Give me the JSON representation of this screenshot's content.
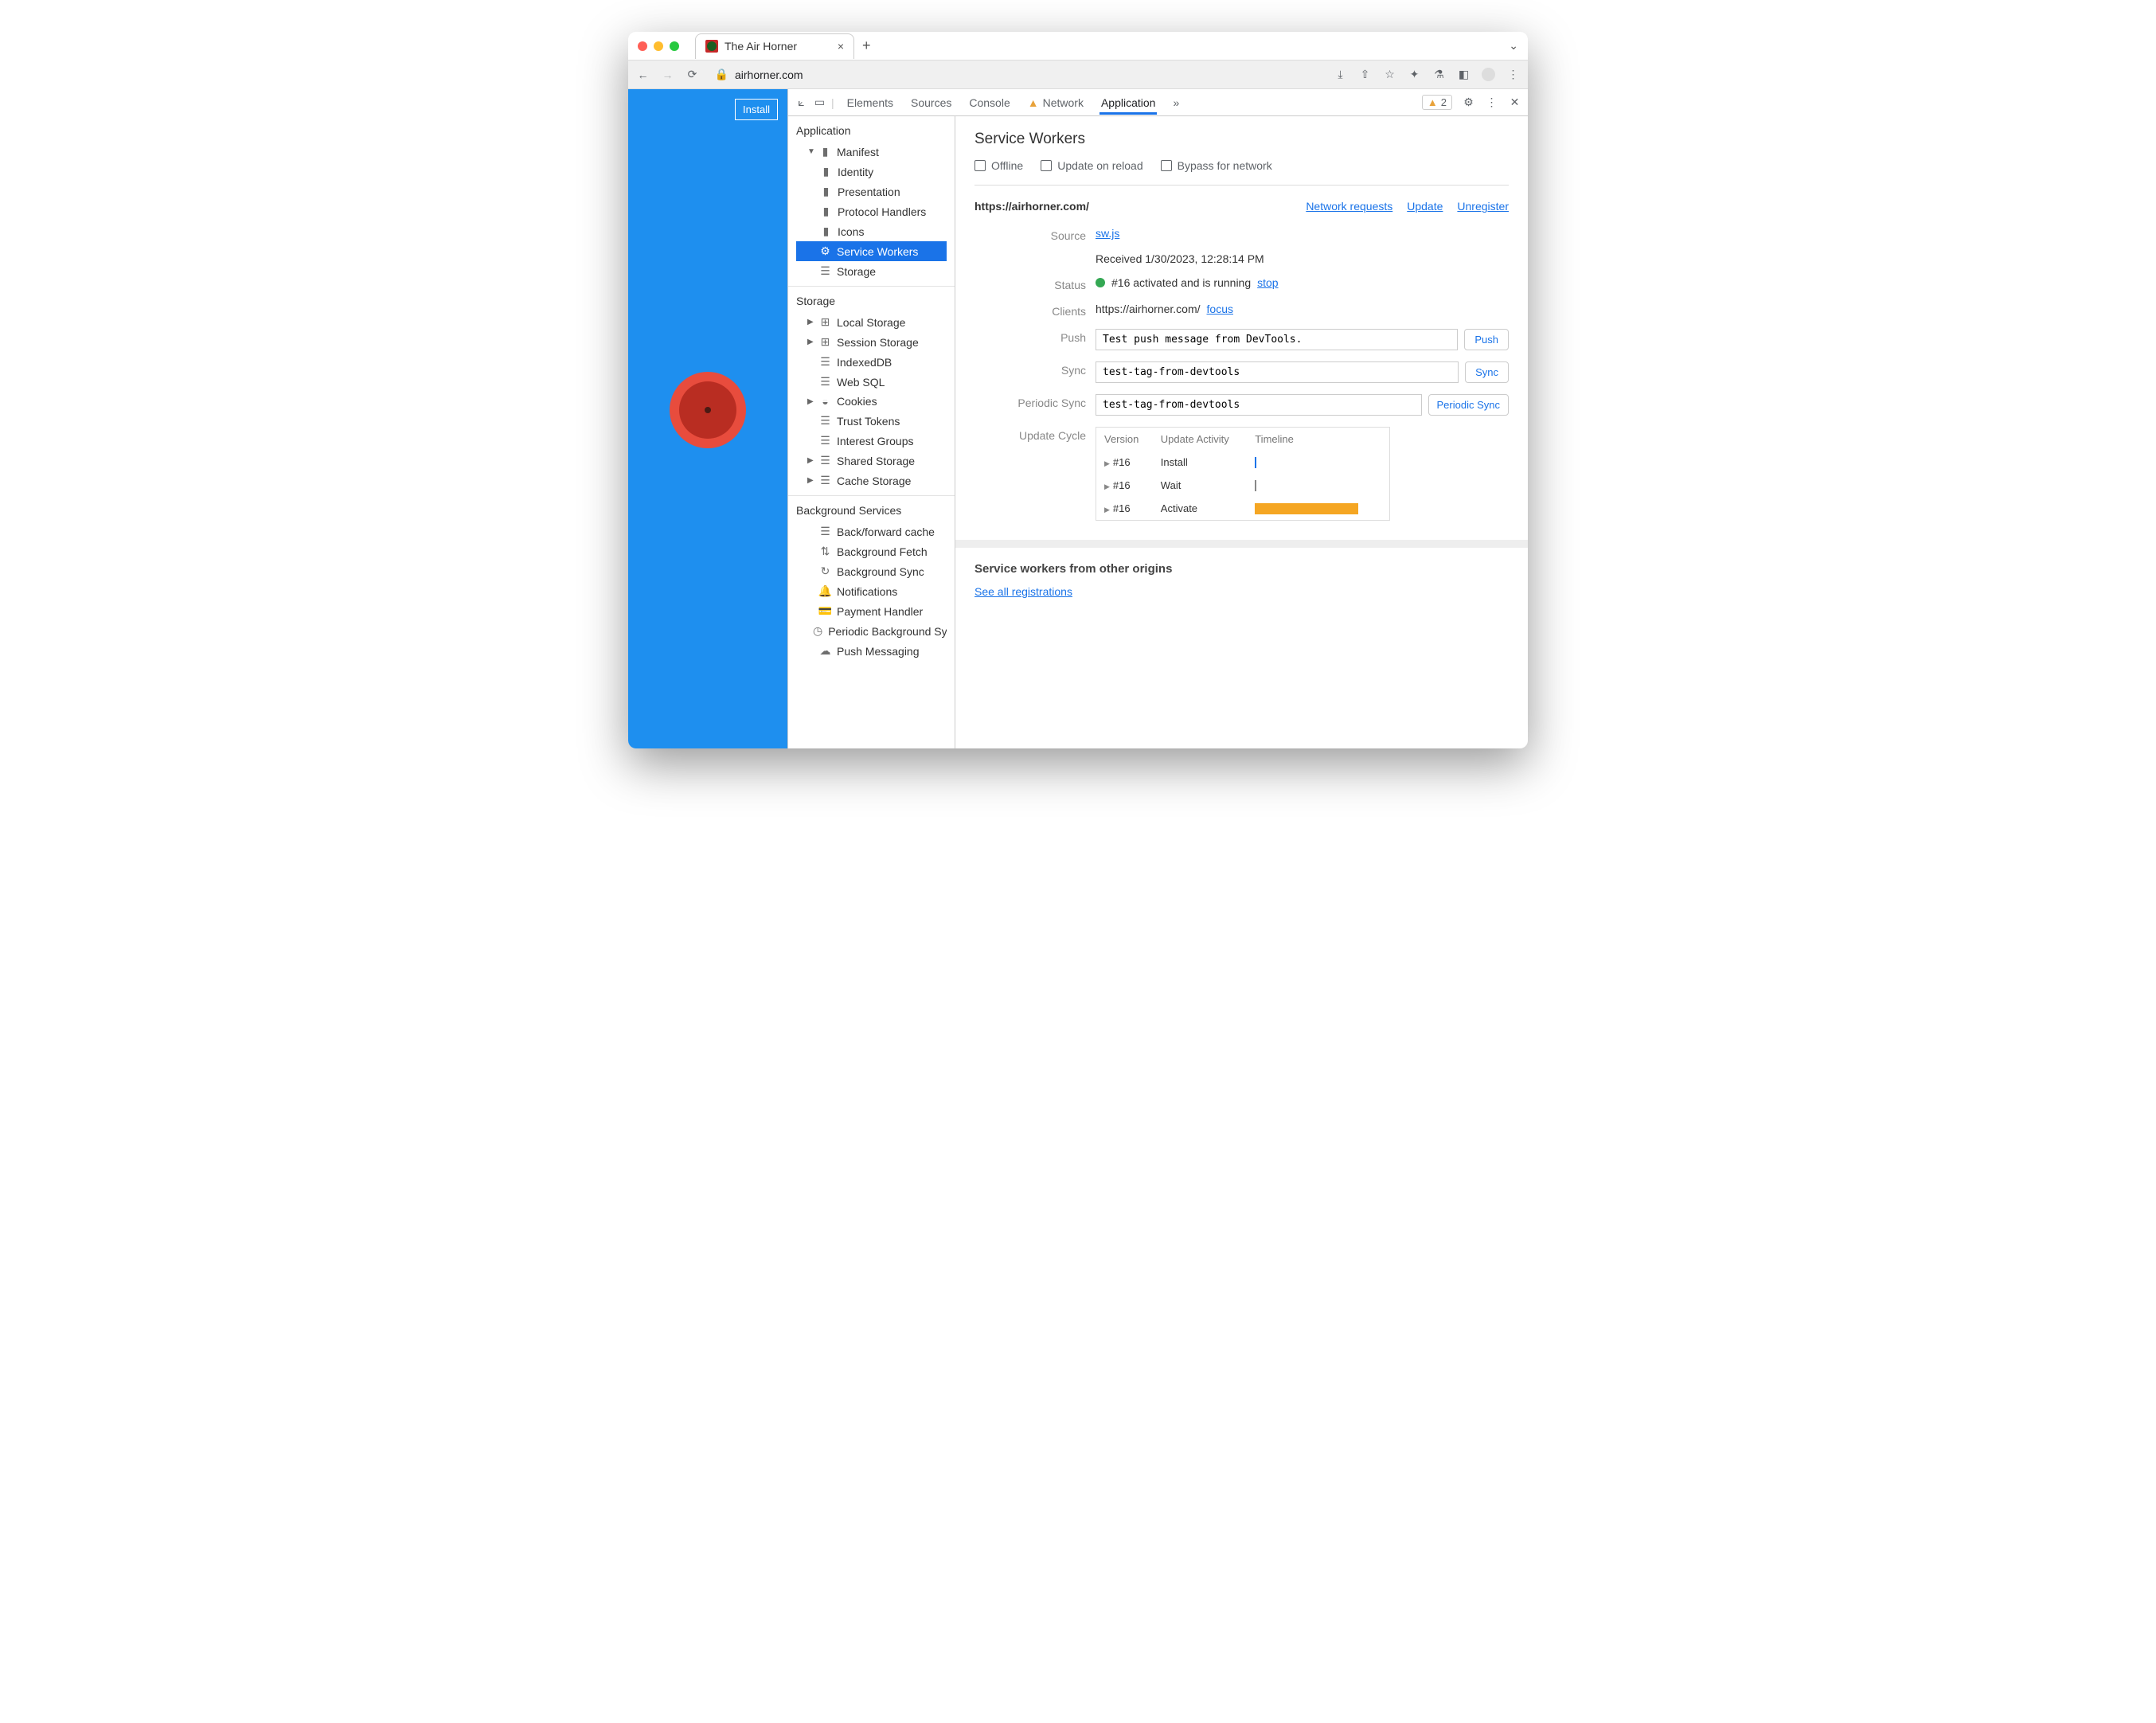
{
  "browser": {
    "tab_title": "The Air Horner",
    "url_display": "airhorner.com"
  },
  "page": {
    "install_label": "Install"
  },
  "devtools": {
    "tabs": {
      "elements": "Elements",
      "sources": "Sources",
      "console": "Console",
      "network": "Network",
      "application": "Application"
    },
    "warning_count": "2"
  },
  "sidebar": {
    "groups": {
      "application": {
        "title": "Application",
        "manifest": "Manifest",
        "identity": "Identity",
        "presentation": "Presentation",
        "protocol": "Protocol Handlers",
        "icons": "Icons",
        "service_workers": "Service Workers",
        "storage": "Storage"
      },
      "storage": {
        "title": "Storage",
        "local": "Local Storage",
        "session": "Session Storage",
        "indexed": "IndexedDB",
        "websql": "Web SQL",
        "cookies": "Cookies",
        "trust": "Trust Tokens",
        "interest": "Interest Groups",
        "shared": "Shared Storage",
        "cache": "Cache Storage"
      },
      "bg": {
        "title": "Background Services",
        "bfcache": "Back/forward cache",
        "bgfetch": "Background Fetch",
        "bgsync": "Background Sync",
        "notif": "Notifications",
        "payment": "Payment Handler",
        "periodic": "Periodic Background Sync",
        "push": "Push Messaging"
      }
    }
  },
  "panel": {
    "heading": "Service Workers",
    "chk_offline": "Offline",
    "chk_update": "Update on reload",
    "chk_bypass": "Bypass for network",
    "scope": "https://airhorner.com/",
    "link_network": "Network requests",
    "link_update": "Update",
    "link_unregister": "Unregister",
    "labels": {
      "source": "Source",
      "status": "Status",
      "clients": "Clients",
      "push": "Push",
      "sync": "Sync",
      "periodic": "Periodic Sync",
      "cycle": "Update Cycle"
    },
    "source_file": "sw.js",
    "received": "Received 1/30/2023, 12:28:14 PM",
    "status_text": "#16 activated and is running",
    "status_stop": "stop",
    "client_url": "https://airhorner.com/",
    "client_focus": "focus",
    "push_value": "Test push message from DevTools.",
    "push_button": "Push",
    "sync_value": "test-tag-from-devtools",
    "sync_button": "Sync",
    "periodic_value": "test-tag-from-devtools",
    "periodic_button": "Periodic Sync",
    "cycle_headers": {
      "version": "Version",
      "activity": "Update Activity",
      "timeline": "Timeline"
    },
    "cycle_rows": [
      {
        "version": "#16",
        "activity": "Install"
      },
      {
        "version": "#16",
        "activity": "Wait"
      },
      {
        "version": "#16",
        "activity": "Activate"
      }
    ],
    "other_heading": "Service workers from other origins",
    "see_all": "See all registrations"
  }
}
